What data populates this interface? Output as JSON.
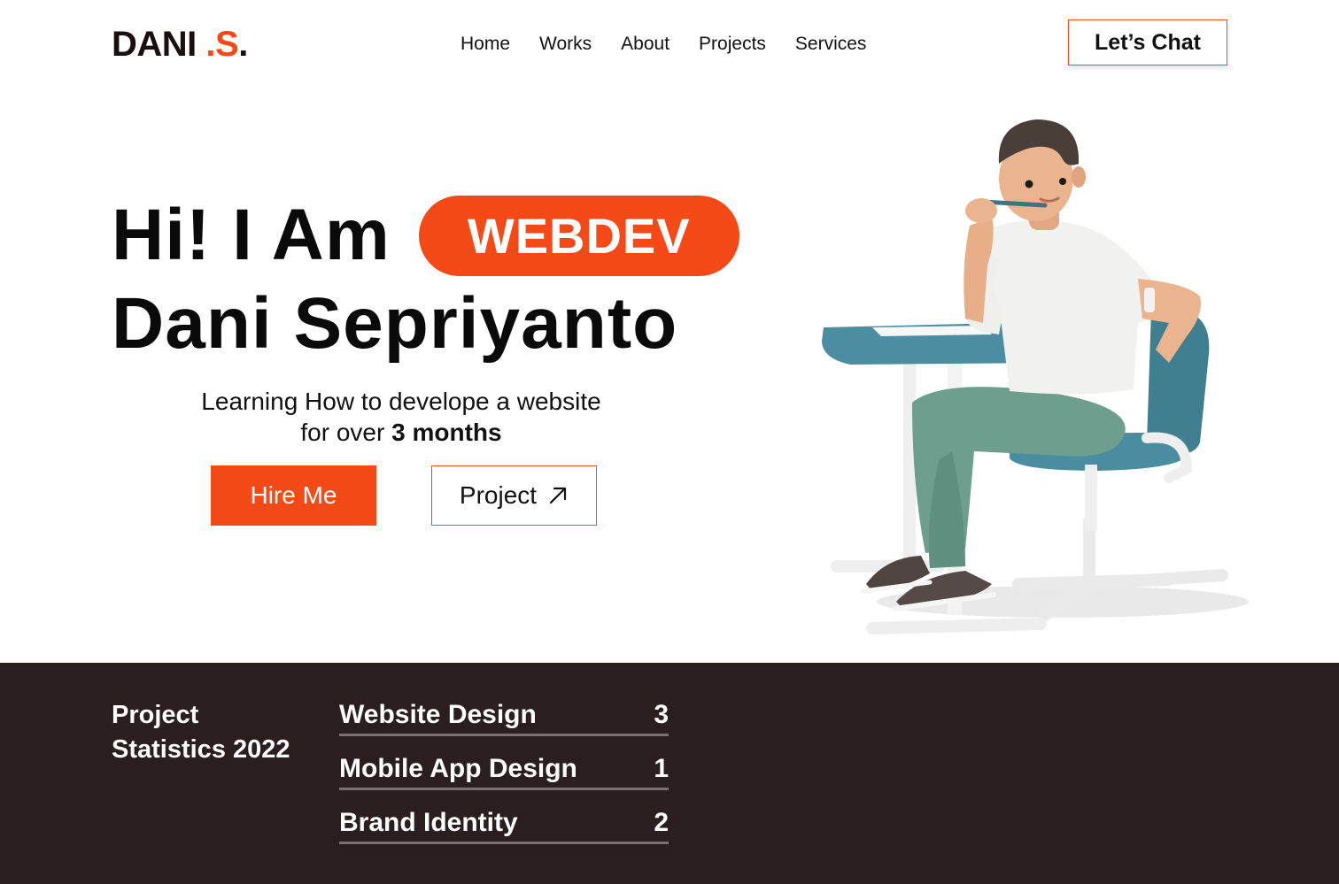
{
  "header": {
    "logo_main": "DANI ",
    "logo_accent": ".S",
    "logo_dot": ".",
    "nav": [
      {
        "label": "Home"
      },
      {
        "label": "Works"
      },
      {
        "label": "About"
      },
      {
        "label": "Projects"
      },
      {
        "label": "Services"
      }
    ],
    "cta_label": "Let’s Chat"
  },
  "hero": {
    "greeting": "Hi! I Am",
    "role_badge": "WEBDEV",
    "name": "Dani Sepriyanto",
    "tagline_line1": "Learning How to develope a website",
    "tagline_prefix": "for over ",
    "tagline_highlight": "3 months",
    "primary_button": "Hire Me",
    "secondary_button": "Project",
    "secondary_icon": "arrow-up-right-icon"
  },
  "stats": {
    "title": "Project Statistics 2022",
    "items": [
      {
        "label": "Website Design",
        "value": "3"
      },
      {
        "label": "Mobile App Design",
        "value": "1"
      },
      {
        "label": "Brand Identity",
        "value": "2"
      }
    ]
  },
  "colors": {
    "accent": "#f54a17",
    "dark_band": "#2a1e1e",
    "text": "#0d0d0d"
  }
}
